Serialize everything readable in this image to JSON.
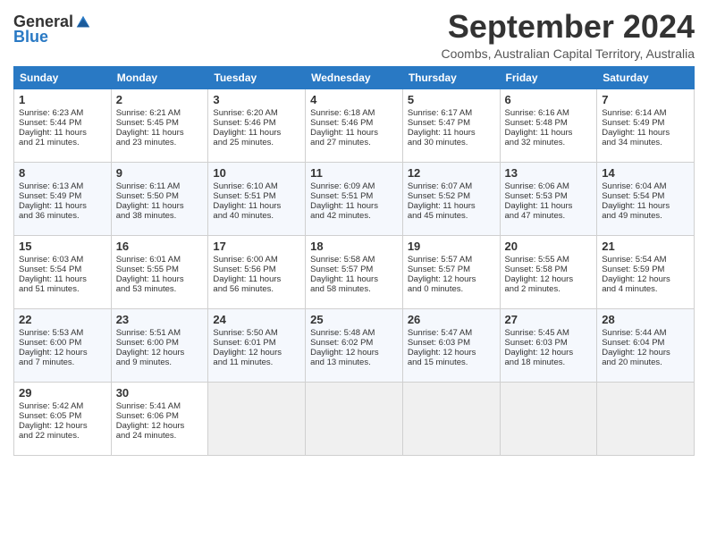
{
  "header": {
    "logo_general": "General",
    "logo_blue": "Blue",
    "month": "September 2024",
    "location": "Coombs, Australian Capital Territory, Australia"
  },
  "days_of_week": [
    "Sunday",
    "Monday",
    "Tuesday",
    "Wednesday",
    "Thursday",
    "Friday",
    "Saturday"
  ],
  "weeks": [
    [
      {
        "day": 1,
        "sunrise": "Sunrise: 6:23 AM",
        "sunset": "Sunset: 5:44 PM",
        "daylight": "Daylight: 11 hours and 21 minutes."
      },
      {
        "day": 2,
        "sunrise": "Sunrise: 6:21 AM",
        "sunset": "Sunset: 5:45 PM",
        "daylight": "Daylight: 11 hours and 23 minutes."
      },
      {
        "day": 3,
        "sunrise": "Sunrise: 6:20 AM",
        "sunset": "Sunset: 5:46 PM",
        "daylight": "Daylight: 11 hours and 25 minutes."
      },
      {
        "day": 4,
        "sunrise": "Sunrise: 6:18 AM",
        "sunset": "Sunset: 5:46 PM",
        "daylight": "Daylight: 11 hours and 27 minutes."
      },
      {
        "day": 5,
        "sunrise": "Sunrise: 6:17 AM",
        "sunset": "Sunset: 5:47 PM",
        "daylight": "Daylight: 11 hours and 30 minutes."
      },
      {
        "day": 6,
        "sunrise": "Sunrise: 6:16 AM",
        "sunset": "Sunset: 5:48 PM",
        "daylight": "Daylight: 11 hours and 32 minutes."
      },
      {
        "day": 7,
        "sunrise": "Sunrise: 6:14 AM",
        "sunset": "Sunset: 5:49 PM",
        "daylight": "Daylight: 11 hours and 34 minutes."
      }
    ],
    [
      {
        "day": 8,
        "sunrise": "Sunrise: 6:13 AM",
        "sunset": "Sunset: 5:49 PM",
        "daylight": "Daylight: 11 hours and 36 minutes."
      },
      {
        "day": 9,
        "sunrise": "Sunrise: 6:11 AM",
        "sunset": "Sunset: 5:50 PM",
        "daylight": "Daylight: 11 hours and 38 minutes."
      },
      {
        "day": 10,
        "sunrise": "Sunrise: 6:10 AM",
        "sunset": "Sunset: 5:51 PM",
        "daylight": "Daylight: 11 hours and 40 minutes."
      },
      {
        "day": 11,
        "sunrise": "Sunrise: 6:09 AM",
        "sunset": "Sunset: 5:51 PM",
        "daylight": "Daylight: 11 hours and 42 minutes."
      },
      {
        "day": 12,
        "sunrise": "Sunrise: 6:07 AM",
        "sunset": "Sunset: 5:52 PM",
        "daylight": "Daylight: 11 hours and 45 minutes."
      },
      {
        "day": 13,
        "sunrise": "Sunrise: 6:06 AM",
        "sunset": "Sunset: 5:53 PM",
        "daylight": "Daylight: 11 hours and 47 minutes."
      },
      {
        "day": 14,
        "sunrise": "Sunrise: 6:04 AM",
        "sunset": "Sunset: 5:54 PM",
        "daylight": "Daylight: 11 hours and 49 minutes."
      }
    ],
    [
      {
        "day": 15,
        "sunrise": "Sunrise: 6:03 AM",
        "sunset": "Sunset: 5:54 PM",
        "daylight": "Daylight: 11 hours and 51 minutes."
      },
      {
        "day": 16,
        "sunrise": "Sunrise: 6:01 AM",
        "sunset": "Sunset: 5:55 PM",
        "daylight": "Daylight: 11 hours and 53 minutes."
      },
      {
        "day": 17,
        "sunrise": "Sunrise: 6:00 AM",
        "sunset": "Sunset: 5:56 PM",
        "daylight": "Daylight: 11 hours and 56 minutes."
      },
      {
        "day": 18,
        "sunrise": "Sunrise: 5:58 AM",
        "sunset": "Sunset: 5:57 PM",
        "daylight": "Daylight: 11 hours and 58 minutes."
      },
      {
        "day": 19,
        "sunrise": "Sunrise: 5:57 AM",
        "sunset": "Sunset: 5:57 PM",
        "daylight": "Daylight: 12 hours and 0 minutes."
      },
      {
        "day": 20,
        "sunrise": "Sunrise: 5:55 AM",
        "sunset": "Sunset: 5:58 PM",
        "daylight": "Daylight: 12 hours and 2 minutes."
      },
      {
        "day": 21,
        "sunrise": "Sunrise: 5:54 AM",
        "sunset": "Sunset: 5:59 PM",
        "daylight": "Daylight: 12 hours and 4 minutes."
      }
    ],
    [
      {
        "day": 22,
        "sunrise": "Sunrise: 5:53 AM",
        "sunset": "Sunset: 6:00 PM",
        "daylight": "Daylight: 12 hours and 7 minutes."
      },
      {
        "day": 23,
        "sunrise": "Sunrise: 5:51 AM",
        "sunset": "Sunset: 6:00 PM",
        "daylight": "Daylight: 12 hours and 9 minutes."
      },
      {
        "day": 24,
        "sunrise": "Sunrise: 5:50 AM",
        "sunset": "Sunset: 6:01 PM",
        "daylight": "Daylight: 12 hours and 11 minutes."
      },
      {
        "day": 25,
        "sunrise": "Sunrise: 5:48 AM",
        "sunset": "Sunset: 6:02 PM",
        "daylight": "Daylight: 12 hours and 13 minutes."
      },
      {
        "day": 26,
        "sunrise": "Sunrise: 5:47 AM",
        "sunset": "Sunset: 6:03 PM",
        "daylight": "Daylight: 12 hours and 15 minutes."
      },
      {
        "day": 27,
        "sunrise": "Sunrise: 5:45 AM",
        "sunset": "Sunset: 6:03 PM",
        "daylight": "Daylight: 12 hours and 18 minutes."
      },
      {
        "day": 28,
        "sunrise": "Sunrise: 5:44 AM",
        "sunset": "Sunset: 6:04 PM",
        "daylight": "Daylight: 12 hours and 20 minutes."
      }
    ],
    [
      {
        "day": 29,
        "sunrise": "Sunrise: 5:42 AM",
        "sunset": "Sunset: 6:05 PM",
        "daylight": "Daylight: 12 hours and 22 minutes."
      },
      {
        "day": 30,
        "sunrise": "Sunrise: 5:41 AM",
        "sunset": "Sunset: 6:06 PM",
        "daylight": "Daylight: 12 hours and 24 minutes."
      },
      null,
      null,
      null,
      null,
      null
    ]
  ]
}
